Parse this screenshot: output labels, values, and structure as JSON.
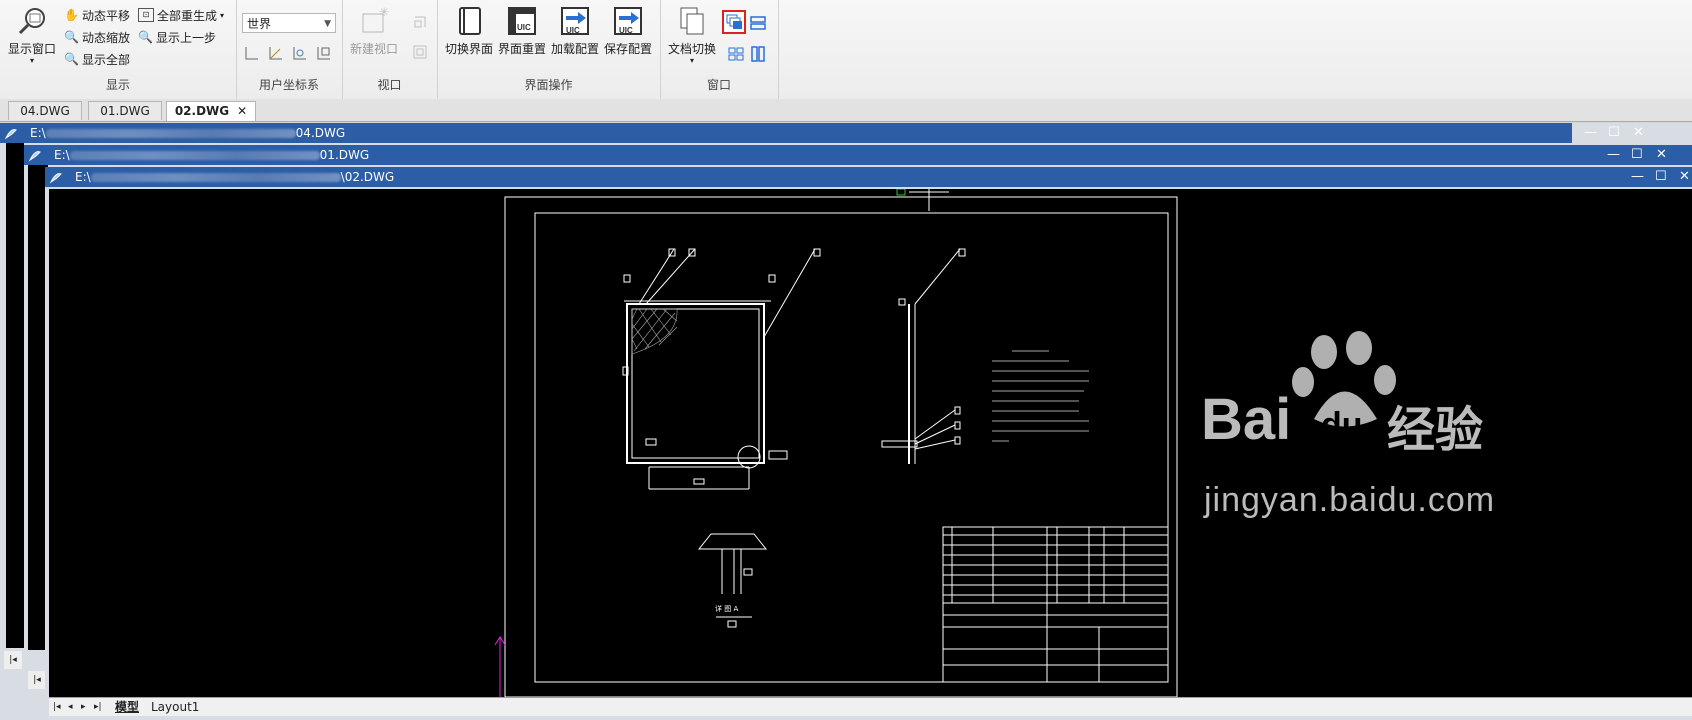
{
  "ribbon": {
    "display": {
      "show_window": "显示窗口",
      "pan": "动态平移",
      "zoom": "动态缩放",
      "show_all": "显示全部",
      "regen_all": "全部重生成",
      "prev_view": "显示上一步",
      "group_label": "显示"
    },
    "ucs": {
      "combo_value": "世界",
      "group_label": "用户坐标系"
    },
    "viewport": {
      "new_viewport": "新建视口",
      "group_label": "视口"
    },
    "ui_ops": {
      "switch_ui": "切换界面",
      "reset_ui": "界面重置",
      "load_config": "加载配置",
      "save_config": "保存配置",
      "group_label": "界面操作"
    },
    "window": {
      "doc_switch": "文档切换",
      "group_label": "窗口"
    }
  },
  "tabs": [
    {
      "label": "04.DWG"
    },
    {
      "label": "01.DWG"
    },
    {
      "label": "02.DWG"
    }
  ],
  "windows": [
    {
      "prefix": "E:\\",
      "suffix": "04.DWG"
    },
    {
      "prefix": "E:\\",
      "suffix": "01.DWG"
    },
    {
      "prefix": "E:\\",
      "suffix": "\\02.DWG"
    }
  ],
  "bottom_tabs": {
    "model": "模型",
    "layout1": "Layout1"
  },
  "drawing": {
    "view_label": "详 图 A"
  },
  "watermark": {
    "brand": "Bai",
    "brand2": "du",
    "cn": "经验",
    "url": "jingyan.baidu.com"
  },
  "colors": {
    "title_bar": "#2b5ea7",
    "canvas": "#000000",
    "highlight": "#e02020"
  }
}
